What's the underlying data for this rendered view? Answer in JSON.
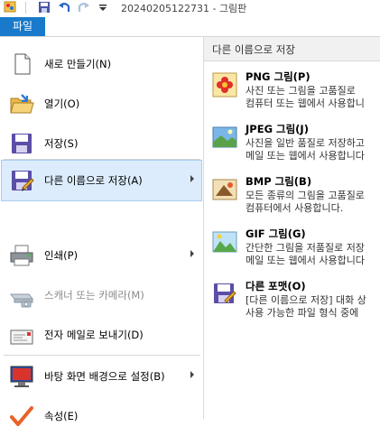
{
  "titlebar": {
    "title": "20240205122731 - 그림판"
  },
  "file_tab": {
    "label": "파일"
  },
  "left_menu": [
    {
      "label": "새로 만들기(N)",
      "icon": "new-document-icon",
      "submenu": false,
      "disabled": false,
      "selected": false
    },
    {
      "label": "열기(O)",
      "icon": "open-folder-icon",
      "submenu": false,
      "disabled": false,
      "selected": false
    },
    {
      "label": "저장(S)",
      "icon": "save-disk-icon",
      "submenu": false,
      "disabled": false,
      "selected": false
    },
    {
      "label": "다른 이름으로 저장(A)",
      "icon": "save-as-icon",
      "submenu": true,
      "disabled": false,
      "selected": true
    },
    {
      "label": "인쇄(P)",
      "icon": "printer-icon",
      "submenu": true,
      "disabled": false,
      "selected": false
    },
    {
      "label": "스캐너 또는 카메라(M)",
      "icon": "scanner-camera-icon",
      "submenu": false,
      "disabled": true,
      "selected": false
    },
    {
      "label": "전자 메일로 보내기(D)",
      "icon": "email-icon",
      "submenu": false,
      "disabled": false,
      "selected": false
    },
    {
      "label": "바탕 화면 배경으로 설정(B)",
      "icon": "desktop-background-icon",
      "submenu": true,
      "disabled": false,
      "selected": false
    },
    {
      "label": "속성(E)",
      "icon": "properties-check-icon",
      "submenu": false,
      "disabled": false,
      "selected": false
    }
  ],
  "right_pane": {
    "header": "다른 이름으로 저장",
    "options": [
      {
        "title": "PNG 그림(P)",
        "desc1": "사진 또는 그림을 고품질로",
        "desc2": "컴퓨터 또는 웹에서 사용합니",
        "icon": "png-flower-icon"
      },
      {
        "title": "JPEG 그림(J)",
        "desc1": "사진을 일반 품질로 저장하고",
        "desc2": "메일 또는 웹에서 사용합니다",
        "icon": "jpeg-landscape-icon"
      },
      {
        "title": "BMP 그림(B)",
        "desc1": "모든 종류의 그림을 고품질로",
        "desc2": "컴퓨터에서 사용합니다.",
        "icon": "bmp-image-icon"
      },
      {
        "title": "GIF 그림(G)",
        "desc1": "간단한 그림을 저품질로 저장",
        "desc2": "메일 또는 웹에서 사용합니다",
        "icon": "gif-landscape-icon"
      },
      {
        "title": "다른 포맷(O)",
        "desc1": "[다른 이름으로 저장] 대화 상",
        "desc2": "사용 가능한 파일 형식 중에",
        "icon": "other-format-icon"
      }
    ]
  },
  "colors": {
    "file_tab": "#1979ca",
    "selected_bg": "#dcecfc"
  }
}
